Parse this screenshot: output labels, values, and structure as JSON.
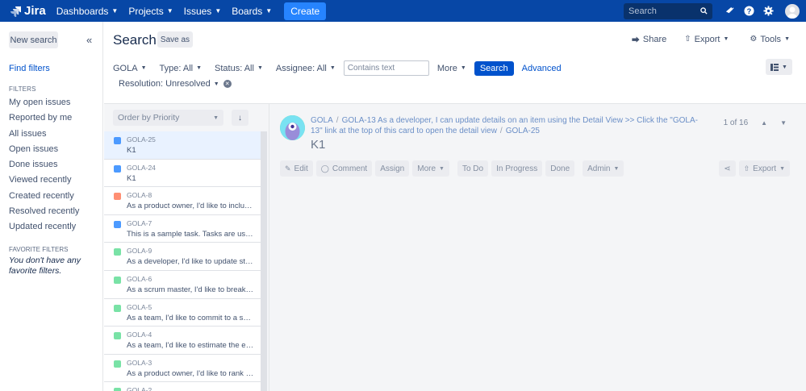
{
  "topbar": {
    "logo": "Jira",
    "nav": [
      {
        "label": "Dashboards"
      },
      {
        "label": "Projects"
      },
      {
        "label": "Issues"
      },
      {
        "label": "Boards"
      }
    ],
    "create_label": "Create",
    "search_placeholder": "Search"
  },
  "sidebar": {
    "new_search": "New search",
    "collapse": "«",
    "find_filters": "Find filters",
    "filters_heading": "FILTERS",
    "filters": [
      "My open issues",
      "Reported by me",
      "All issues",
      "Open issues",
      "Done issues",
      "Viewed recently",
      "Created recently",
      "Resolved recently",
      "Updated recently"
    ],
    "favorites_heading": "FAVORITE FILTERS",
    "favorites_empty": "You don't have any favorite filters."
  },
  "header": {
    "title": "Search",
    "save_as": "Save as",
    "share": "Share",
    "export": "Export",
    "tools": "Tools"
  },
  "filterbar": {
    "project": "GOLA",
    "type": "Type: All",
    "status": "Status: All",
    "assignee": "Assignee: All",
    "contains_placeholder": "Contains text",
    "more": "More",
    "search": "Search",
    "advanced": "Advanced",
    "resolution": "Resolution: Unresolved"
  },
  "list": {
    "order_by": "Order by Priority",
    "issues": [
      {
        "key": "GOLA-25",
        "summary": "K1",
        "type": "subtask",
        "color": "#4c9aff"
      },
      {
        "key": "GOLA-24",
        "summary": "K1",
        "type": "subtask",
        "color": "#4c9aff"
      },
      {
        "key": "GOLA-8",
        "summary": "As a product owner, I'd like to include bugs, tasks and other issue types in my backlog",
        "type": "bug",
        "color": "#ff8f73"
      },
      {
        "key": "GOLA-7",
        "summary": "This is a sample task. Tasks are used to break down stories",
        "type": "task",
        "color": "#4c9aff"
      },
      {
        "key": "GOLA-9",
        "summary": "As a developer, I'd like to update story status during the sprint",
        "type": "story",
        "color": "#79e2a6"
      },
      {
        "key": "GOLA-6",
        "summary": "As a scrum master, I'd like to break stories into tasks",
        "type": "story",
        "color": "#79e2a6"
      },
      {
        "key": "GOLA-5",
        "summary": "As a team, I'd like to commit to a set of stories",
        "type": "story",
        "color": "#79e2a6"
      },
      {
        "key": "GOLA-4",
        "summary": "As a team, I'd like to estimate the effort of a story",
        "type": "story",
        "color": "#79e2a6"
      },
      {
        "key": "GOLA-3",
        "summary": "As a product owner, I'd like to rank stories in the backlog",
        "type": "story",
        "color": "#79e2a6"
      },
      {
        "key": "GOLA-2",
        "summary": "",
        "type": "story",
        "color": "#79e2a6"
      }
    ]
  },
  "detail": {
    "crumb_project": "GOLA",
    "crumb_parent": "GOLA-13 As a developer, I can update details on an item using the Detail View >> Click the \"GOLA-13\" link at the top of this card to open the detail view",
    "crumb_key": "GOLA-25",
    "title": "K1",
    "paging": "1 of 16",
    "toolbar": {
      "edit": "Edit",
      "comment": "Comment",
      "assign": "Assign",
      "more": "More",
      "todo": "To Do",
      "in_progress": "In Progress",
      "done": "Done",
      "admin": "Admin",
      "export": "Export"
    }
  }
}
